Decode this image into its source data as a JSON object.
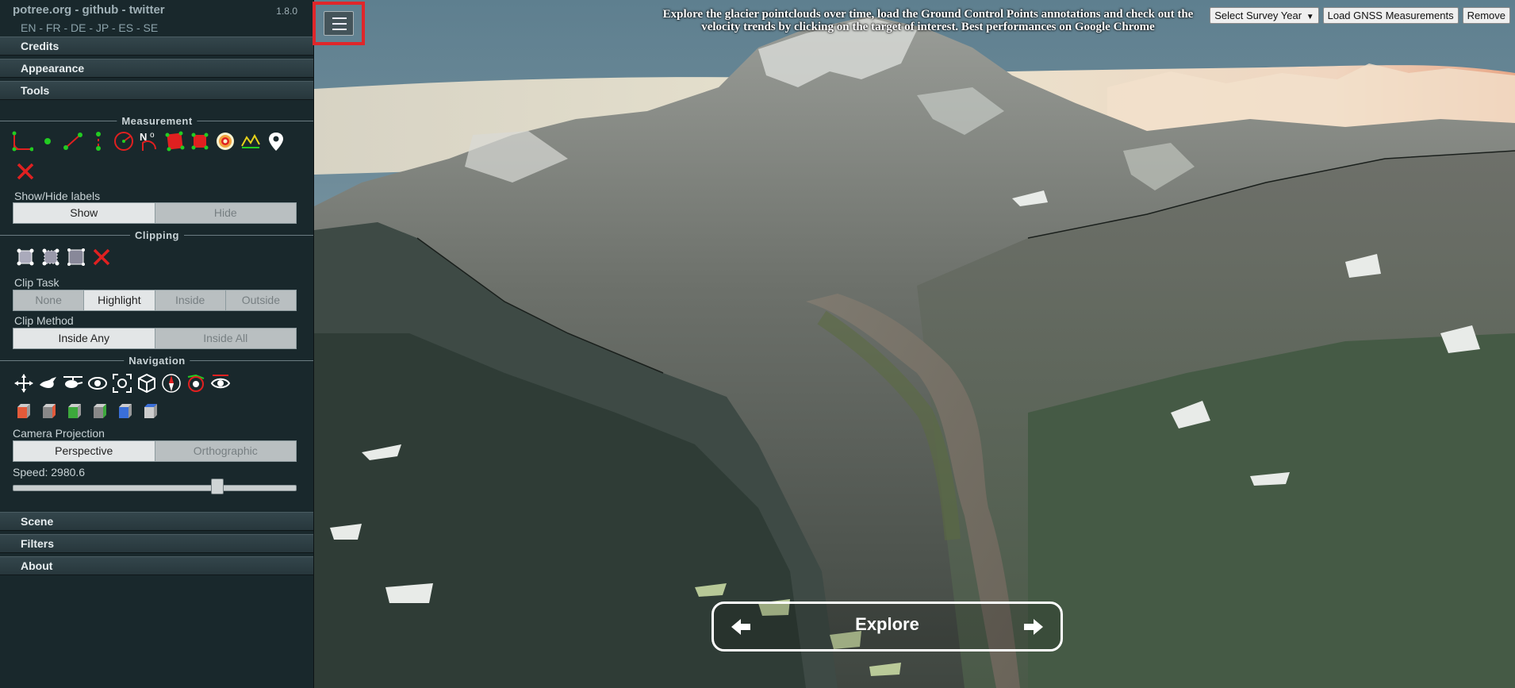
{
  "sidebar": {
    "brand": "potree.org - github - twitter",
    "version": "1.8.0",
    "languages": "EN - FR - DE - JP - ES - SE",
    "sections": {
      "credits": "Credits",
      "appearance": "Appearance",
      "tools": "Tools",
      "scene": "Scene",
      "filters": "Filters",
      "about": "About"
    },
    "measurement": {
      "title": "Measurement",
      "tools": [
        "angle-icon",
        "point-icon",
        "distance-icon",
        "height-icon",
        "circle-icon",
        "azimuth-icon",
        "area-icon",
        "volume-icon",
        "sphere-volume-icon",
        "profile-icon",
        "annotation-icon",
        "remove-all-icon"
      ],
      "show_hide_label": "Show/Hide labels",
      "show": "Show",
      "hide": "Hide"
    },
    "clipping": {
      "title": "Clipping",
      "tools": [
        "clip-volume-icon",
        "clip-polygon-icon",
        "screen-clip-box-icon",
        "remove-clipping-icon"
      ],
      "task_label": "Clip Task",
      "task_options": [
        "None",
        "Highlight",
        "Inside",
        "Outside"
      ],
      "task_selected": "Highlight",
      "method_label": "Clip Method",
      "method_options": [
        "Inside Any",
        "Inside All"
      ],
      "method_selected": "Inside Any"
    },
    "navigation": {
      "title": "Navigation",
      "tools": [
        "earth-controls-icon",
        "fly-controls-icon",
        "heli-controls-icon",
        "orbit-controls-icon",
        "focus-icon",
        "full-extent-icon",
        "navigation-cube-icon",
        "compass-icon",
        "camera-animation-icon"
      ],
      "views": [
        "left-view-icon",
        "front-view-icon",
        "top-view-icon",
        "back-view-icon",
        "right-view-icon",
        "bottom-view-icon"
      ],
      "projection_label": "Camera Projection",
      "projection_options": [
        "Perspective",
        "Orthographic"
      ],
      "projection_selected": "Perspective",
      "speed_label": "Speed: 2980.6",
      "speed_fraction": 0.73
    }
  },
  "viewport": {
    "banner_line1": "Explore the glacier pointclouds over time, load the Ground Control Points annotations and check out the",
    "banner_line2": "velocity trends by clicking on the target of interest. Best performances on Google Chrome",
    "survey_select": "Select Survey Year",
    "load_gnss": "Load GNSS Measurements",
    "remove": "Remove",
    "explore": "Explore",
    "menu_toggle_color": "#e0262a"
  }
}
